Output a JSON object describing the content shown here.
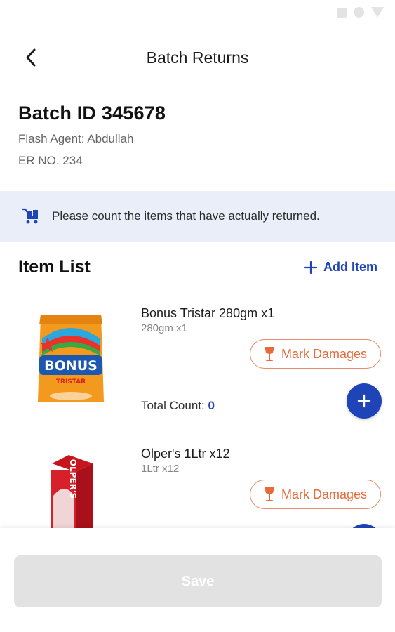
{
  "header": {
    "title": "Batch Returns"
  },
  "batch": {
    "id_label": "Batch ID 345678",
    "agent_label": "Flash Agent: Abdullah",
    "er_label": "ER NO. 234"
  },
  "banner": {
    "text": "Please count the items that have actually returned."
  },
  "item_list": {
    "title": "Item List",
    "add_label": "Add Item",
    "items": [
      {
        "name": "Bonus Tristar 280gm x1",
        "sub": "280gm x1",
        "mark_label": "Mark Damages",
        "total_label": "Total Count:",
        "total_value": "0",
        "image_text": "BONUS",
        "image_subtext": "TRISTAR"
      },
      {
        "name": "Olper's 1Ltr x12",
        "sub": "1Ltr x12",
        "mark_label": "Mark Damages",
        "image_text": "OLPER'S"
      }
    ]
  },
  "footer": {
    "save_label": "Save"
  },
  "colors": {
    "accent": "#1e44b8",
    "damage": "#e56a3c",
    "banner_bg": "#e9eef8",
    "disabled_bg": "#e2e2e2"
  }
}
